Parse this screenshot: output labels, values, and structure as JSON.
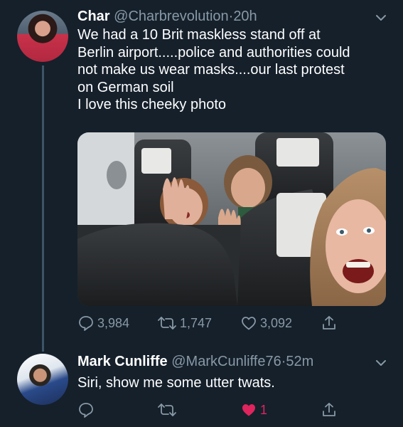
{
  "tweet": {
    "author_name": "Char",
    "author_handle": "@Charbrevolution",
    "separator": "·",
    "time": "20h",
    "text_lines": [
      "We had a 10 Brit maskless stand off at",
      "Berlin airport.....police and authorities could",
      "not make us wear masks....our last protest",
      "on German soil",
      "I love this cheeky photo"
    ],
    "photo_icon": "airplane-selfie-photo",
    "reply_count": "3,984",
    "retweet_count": "1,747",
    "like_count": "3,092"
  },
  "reply": {
    "author_name": "Mark Cunliffe",
    "author_handle": "@MarkCunliffe76",
    "separator": "·",
    "time": "52m",
    "text": "Siri, show me some utter twats.",
    "like_count": "1"
  },
  "colors": {
    "background": "#15202b",
    "secondary_text": "#8899a6",
    "like_active": "#e0245e",
    "thread_line": "#3d5466"
  }
}
